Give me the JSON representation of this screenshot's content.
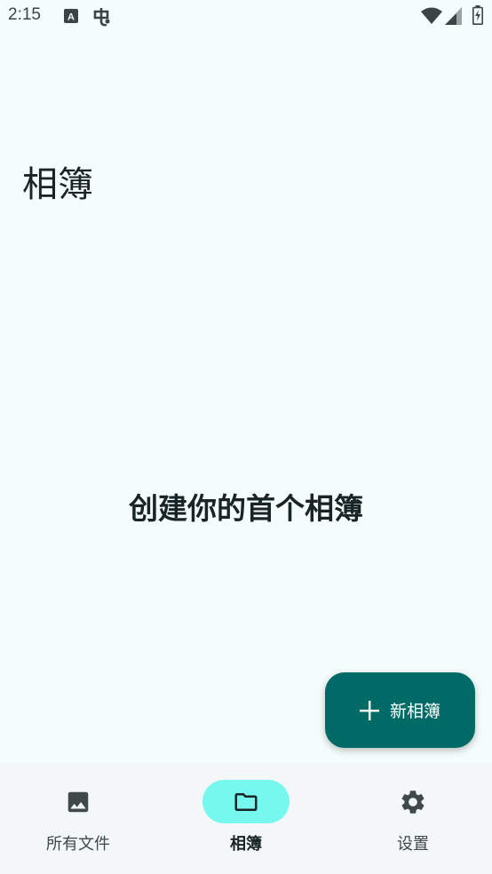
{
  "status_bar": {
    "time": "2:15",
    "icons": [
      "a-notification-icon",
      "bug-icon",
      "wifi-icon",
      "signal-icon",
      "battery-charging-icon"
    ]
  },
  "page": {
    "title": "相簿",
    "empty_message": "创建你的首个相簿"
  },
  "fab": {
    "icon": "plus-icon",
    "label": "新相簿"
  },
  "bottom_nav": {
    "items": [
      {
        "icon": "image-icon",
        "label": "所有文件",
        "active": false
      },
      {
        "icon": "folder-icon",
        "label": "相簿",
        "active": true
      },
      {
        "icon": "gear-icon",
        "label": "设置",
        "active": false
      }
    ]
  },
  "colors": {
    "background": "#f5fcfc",
    "fab": "#006a66",
    "nav_active_indicator": "#76f8ee",
    "text": "#182426"
  }
}
